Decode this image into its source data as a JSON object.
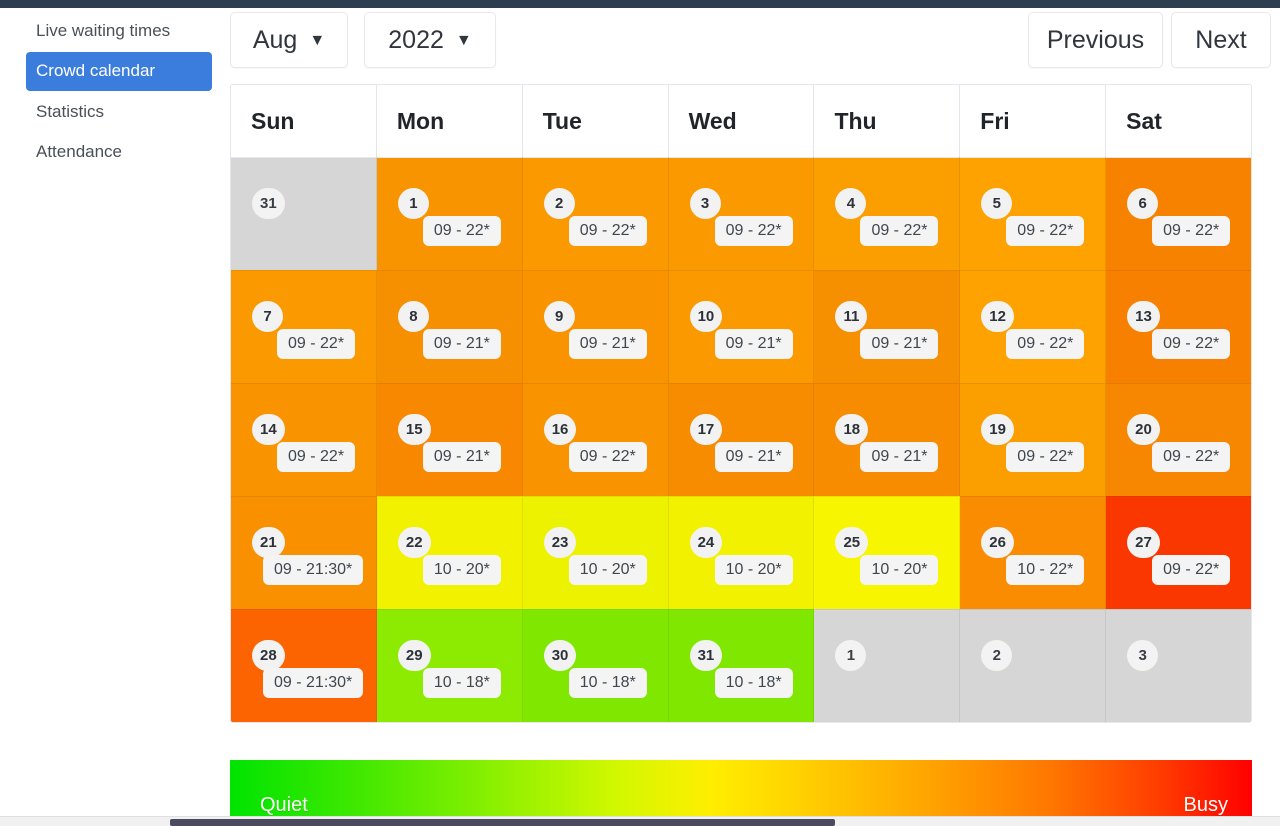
{
  "sidebar": {
    "items": [
      {
        "label": "Live waiting times",
        "active": false
      },
      {
        "label": "Crowd calendar",
        "active": true
      },
      {
        "label": "Statistics",
        "active": false
      },
      {
        "label": "Attendance",
        "active": false
      }
    ]
  },
  "toolbar": {
    "month_label": "Aug",
    "year_label": "2022",
    "caret": "▼",
    "previous_label": "Previous",
    "next_label": "Next"
  },
  "calendar": {
    "weekday_headers": [
      "Sun",
      "Mon",
      "Tue",
      "Wed",
      "Thu",
      "Fri",
      "Sat"
    ],
    "weeks": [
      [
        {
          "day": "31",
          "time": "",
          "color": "#d6d6d6",
          "muted": true
        },
        {
          "day": "1",
          "time": "09 - 22*",
          "color": "#f79400",
          "muted": false
        },
        {
          "day": "2",
          "time": "09 - 22*",
          "color": "#fb9a00",
          "muted": false
        },
        {
          "day": "3",
          "time": "09 - 22*",
          "color": "#fb9a00",
          "muted": false
        },
        {
          "day": "4",
          "time": "09 - 22*",
          "color": "#fb9e00",
          "muted": false
        },
        {
          "day": "5",
          "time": "09 - 22*",
          "color": "#fda200",
          "muted": false
        },
        {
          "day": "6",
          "time": "09 - 22*",
          "color": "#f78200",
          "muted": false
        }
      ],
      [
        {
          "day": "7",
          "time": "09 - 22*",
          "color": "#fb9a00",
          "muted": false
        },
        {
          "day": "8",
          "time": "09 - 21*",
          "color": "#f79000",
          "muted": false
        },
        {
          "day": "9",
          "time": "09 - 21*",
          "color": "#f99400",
          "muted": false
        },
        {
          "day": "10",
          "time": "09 - 21*",
          "color": "#fb9a00",
          "muted": false
        },
        {
          "day": "11",
          "time": "09 - 21*",
          "color": "#f79000",
          "muted": false
        },
        {
          "day": "12",
          "time": "09 - 22*",
          "color": "#fda200",
          "muted": false
        },
        {
          "day": "13",
          "time": "09 - 22*",
          "color": "#f78000",
          "muted": false
        }
      ],
      [
        {
          "day": "14",
          "time": "09 - 22*",
          "color": "#f99400",
          "muted": false
        },
        {
          "day": "15",
          "time": "09 - 21*",
          "color": "#f78800",
          "muted": false
        },
        {
          "day": "16",
          "time": "09 - 22*",
          "color": "#f99400",
          "muted": false
        },
        {
          "day": "17",
          "time": "09 - 21*",
          "color": "#f78c00",
          "muted": false
        },
        {
          "day": "18",
          "time": "09 - 21*",
          "color": "#f78c00",
          "muted": false
        },
        {
          "day": "19",
          "time": "09 - 22*",
          "color": "#fb9e00",
          "muted": false
        },
        {
          "day": "20",
          "time": "09 - 22*",
          "color": "#f78600",
          "muted": false
        }
      ],
      [
        {
          "day": "21",
          "time": "09 - 21:30*",
          "color": "#f99000",
          "muted": false
        },
        {
          "day": "22",
          "time": "10 - 20*",
          "color": "#f2f200",
          "muted": false
        },
        {
          "day": "23",
          "time": "10 - 20*",
          "color": "#ecf200",
          "muted": false
        },
        {
          "day": "24",
          "time": "10 - 20*",
          "color": "#f2f200",
          "muted": false
        },
        {
          "day": "25",
          "time": "10 - 20*",
          "color": "#f7f500",
          "muted": false
        },
        {
          "day": "26",
          "time": "10 - 22*",
          "color": "#f98c00",
          "muted": false
        },
        {
          "day": "27",
          "time": "09 - 22*",
          "color": "#fb3700",
          "muted": false
        }
      ],
      [
        {
          "day": "28",
          "time": "09 - 21:30*",
          "color": "#fb6400",
          "muted": false
        },
        {
          "day": "29",
          "time": "10 - 18*",
          "color": "#8ceb00",
          "muted": false
        },
        {
          "day": "30",
          "time": "10 - 18*",
          "color": "#80e800",
          "muted": false
        },
        {
          "day": "31",
          "time": "10 - 18*",
          "color": "#80e800",
          "muted": false
        },
        {
          "day": "1",
          "time": "",
          "color": "#d6d6d6",
          "muted": true
        },
        {
          "day": "2",
          "time": "",
          "color": "#d6d6d6",
          "muted": true
        },
        {
          "day": "3",
          "time": "",
          "color": "#d6d6d6",
          "muted": true
        }
      ]
    ]
  },
  "legend": {
    "low_label": "Quiet",
    "high_label": "Busy",
    "low_color": "#00e400",
    "high_color": "#ff0000"
  }
}
